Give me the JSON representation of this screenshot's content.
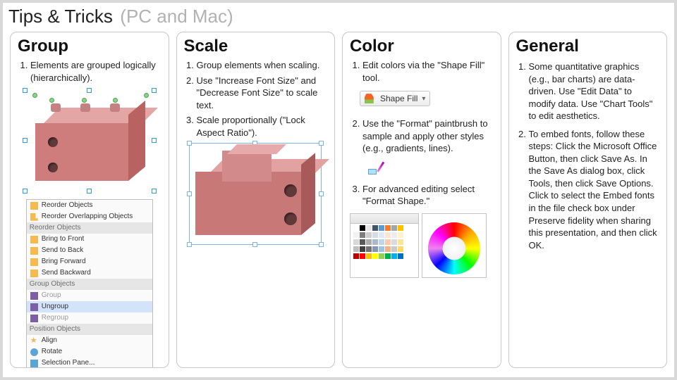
{
  "title": {
    "main": "Tips & Tricks",
    "sub": "(PC and Mac)"
  },
  "columns": {
    "group": {
      "heading": "Group",
      "tips": [
        "Elements are grouped logically (hierarchically)."
      ],
      "menu": {
        "reorder_objects_label": "Reorder Objects",
        "reorder_overlapping_label": "Reorder Overlapping Objects",
        "section_reorder": "Reorder Objects",
        "bring_to_front": "Bring to Front",
        "send_to_back": "Send to Back",
        "bring_forward": "Bring Forward",
        "send_backward": "Send Backward",
        "section_group": "Group Objects",
        "group": "Group",
        "ungroup": "Ungroup",
        "regroup": "Regroup",
        "section_position": "Position Objects",
        "align": "Align",
        "rotate": "Rotate",
        "selection_pane": "Selection Pane..."
      }
    },
    "scale": {
      "heading": "Scale",
      "tips": [
        "Group elements when scaling.",
        "Use \"Increase Font Size\" and \"Decrease Font Size\" to scale text.",
        "Scale proportionally (\"Lock Aspect Ratio\")."
      ]
    },
    "color": {
      "heading": "Color",
      "tips": [
        "Edit colors via the \"Shape Fill\" tool.",
        "Use the \"Format\" paintbrush to sample and apply other styles (e.g., gradients, lines).",
        "For advanced editing select \"Format Shape.\""
      ],
      "shape_fill_label": "Shape Fill"
    },
    "general": {
      "heading": "General",
      "tips": [
        "Some quantitative graphics (e.g., bar charts) are data-driven. Use \"Edit Data\" to modify data. Use \"Chart Tools\" to edit aesthetics.",
        "To embed fonts, follow these steps: Click the Microsoft Office Button, then click Save As. In the Save As dialog box, click Tools, then click Save Options. Click to select the Embed fonts in the file check box under Preserve fidelity when sharing this presentation, and then click OK."
      ]
    }
  }
}
